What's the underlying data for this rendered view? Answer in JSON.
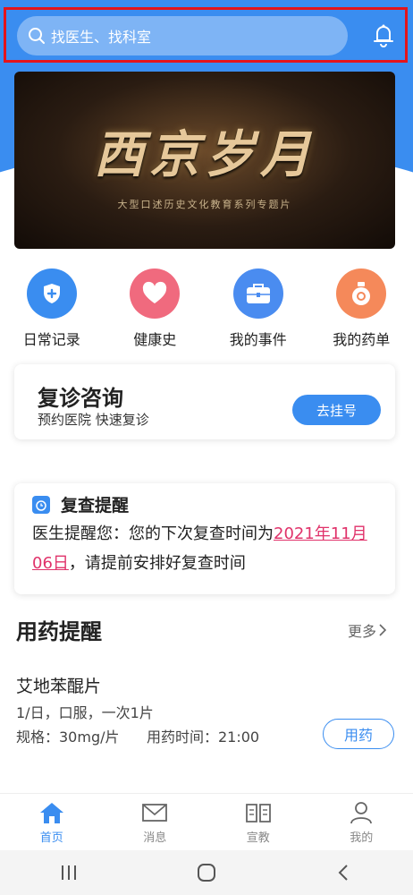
{
  "search": {
    "placeholder": "找医生、找科室"
  },
  "banner": {
    "title": "西京岁月",
    "subtitle": "大型口述历史文化教育系列专题片"
  },
  "quick_actions": [
    {
      "label": "日常记录",
      "icon": "shield-plus-icon",
      "color": "#3a8df0"
    },
    {
      "label": "健康史",
      "icon": "heart-icon",
      "color": "#f06a7e"
    },
    {
      "label": "我的事件",
      "icon": "briefcase-icon",
      "color": "#4a8cf0"
    },
    {
      "label": "我的药单",
      "icon": "medicine-bottle-icon",
      "color": "#f5895a"
    }
  ],
  "revisit": {
    "title": "复诊咨询",
    "subtitle": "预约医院 快速复诊",
    "button": "去挂号"
  },
  "reminder": {
    "title": "复查提醒",
    "text_prefix": "医生提醒您：您的下次复查时间为",
    "date": "2021年11月06日",
    "text_suffix": "，请提前安排好复查时间"
  },
  "medication": {
    "title": "用药提醒",
    "more": "更多",
    "name": "艾地苯醌片",
    "dose": "1/日，口服，一次1片",
    "spec": "规格：30mg/片",
    "time": "用药时间：21:00",
    "button": "用药"
  },
  "tabs": [
    {
      "label": "首页",
      "icon": "home-icon",
      "active": true
    },
    {
      "label": "消息",
      "icon": "mail-icon",
      "active": false
    },
    {
      "label": "宣教",
      "icon": "book-icon",
      "active": false
    },
    {
      "label": "我的",
      "icon": "user-icon",
      "active": false
    }
  ],
  "colors": {
    "primary": "#3a8df0",
    "highlight": "#e0326a",
    "alert_border": "#e4141b"
  }
}
